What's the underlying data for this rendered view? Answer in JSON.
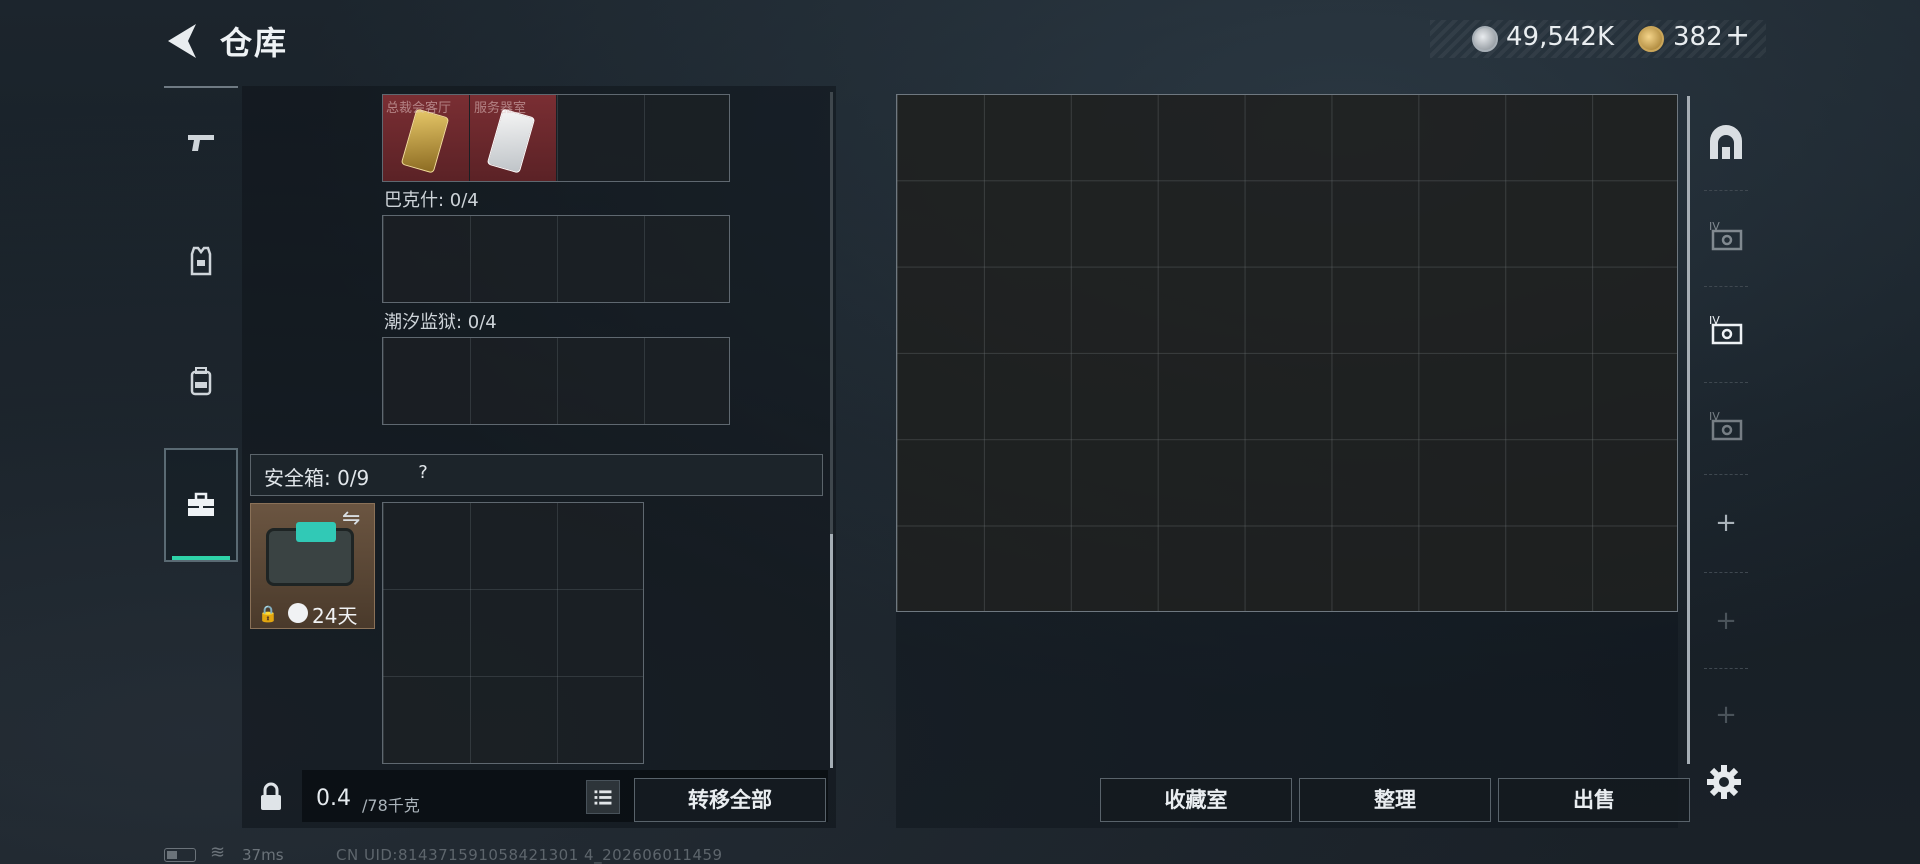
{
  "header": {
    "title": "仓库",
    "silver_amount": "49,542K",
    "gold_amount": "382",
    "gold_plus": "+"
  },
  "left_tabs": [
    {
      "icon": "pistol-icon"
    },
    {
      "icon": "armor-vest-icon"
    },
    {
      "icon": "backpack-icon"
    },
    {
      "icon": "toolbox-icon",
      "active": true
    }
  ],
  "card_section": {
    "tags": [
      "总裁会客厅",
      "服务器室"
    ]
  },
  "sections": {
    "bakesh_label": "巴克什: 0/4",
    "tide_label": "潮汐监狱: 0/4"
  },
  "safebox": {
    "label": "安全箱:  0/9",
    "help": "?",
    "days": "24天",
    "swap": "⇋"
  },
  "left_footer": {
    "weight_value": "0.4",
    "weight_capacity": "/78千克",
    "transfer_all": "转移全部"
  },
  "right_footer": {
    "collection": "收藏室",
    "organize": "整理",
    "sell": "出售"
  },
  "right_tabs": {
    "plus_labels": [
      "+",
      "+",
      "+"
    ]
  },
  "status_bar": {
    "ping": "37ms",
    "uid": "CN UID:814371591058421301 4_202606011459"
  },
  "colors": {
    "accent": "#2ed3a8",
    "card_bg": "#7a2e33",
    "background": "#1c252d"
  }
}
